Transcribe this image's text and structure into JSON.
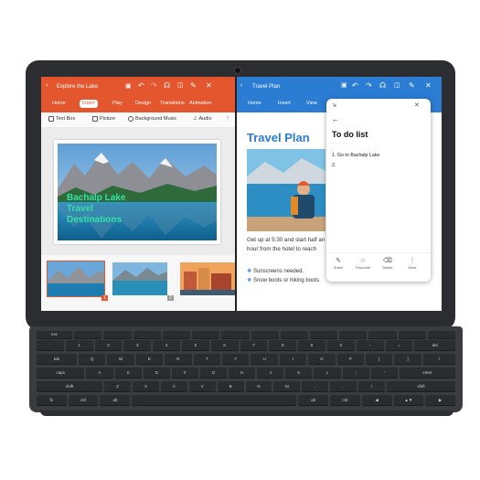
{
  "left_app": {
    "title": "Explore the Lake",
    "tabs": [
      "Home",
      "Insert",
      "Play",
      "Design",
      "Transitions",
      "Animation"
    ],
    "active_tab": "Insert",
    "ribbon": [
      "Text Box",
      "Picture",
      "Background Music",
      "Audio"
    ],
    "slide_text": [
      "Bachalp Lake",
      "Travel",
      "Destinations"
    ],
    "thumb_numbers": [
      "1",
      "2"
    ]
  },
  "right_app": {
    "title": "Travel Plan",
    "tabs": [
      "Home",
      "Insert",
      "View"
    ],
    "doc_title": "Travel Plan",
    "lines": [
      "Get up at 5:30 and start half an",
      "hour from the hotel to reach"
    ],
    "bullets": [
      "Sunscreens needed.",
      "Snow boots or hiking boots"
    ]
  },
  "note": {
    "heading": "To do list",
    "items": [
      "1. Go to Bachalp Lake",
      "2."
    ],
    "buttons": [
      "Share",
      "Favourite",
      "Delete",
      "More"
    ]
  },
  "keyboard_rows": [
    [
      "esc",
      "",
      "",
      "",
      "",
      "",
      "",
      "",
      "",
      "",
      "",
      "",
      "",
      ""
    ],
    [
      "`",
      "1",
      "2",
      "3",
      "4",
      "5",
      "6",
      "7",
      "8",
      "9",
      "0",
      "-",
      "=",
      "del"
    ],
    [
      "tab",
      "Q",
      "W",
      "E",
      "R",
      "T",
      "Y",
      "U",
      "I",
      "O",
      "P",
      "[",
      "]",
      "\\"
    ],
    [
      "caps",
      "A",
      "S",
      "D",
      "F",
      "G",
      "H",
      "J",
      "K",
      "L",
      ";",
      "'",
      "enter"
    ],
    [
      "shift",
      "Z",
      "X",
      "C",
      "V",
      "B",
      "N",
      "M",
      ",",
      ".",
      "/",
      "shift"
    ],
    [
      "fn",
      "ctrl",
      "alt",
      "",
      "alt",
      "ctrl",
      "◀",
      "▲▼",
      "▶"
    ]
  ]
}
